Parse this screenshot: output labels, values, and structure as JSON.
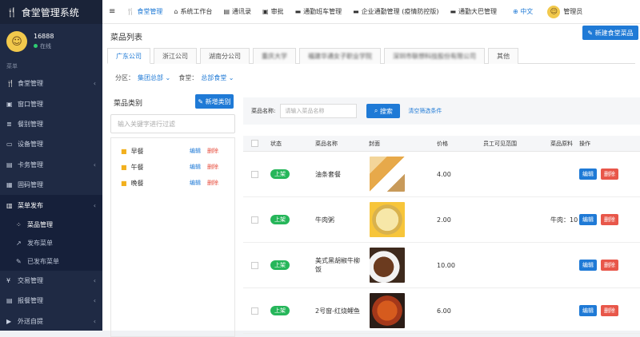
{
  "app": {
    "title": "食堂管理系统"
  },
  "user": {
    "name": "16888",
    "status": "在线"
  },
  "sidebar": {
    "header": "菜单",
    "items": [
      {
        "label": "食堂管理",
        "icon": "fork-knife-icon"
      },
      {
        "label": "窗口管理",
        "icon": "window-icon"
      },
      {
        "label": "餐别管理",
        "icon": "list-icon"
      },
      {
        "label": "设备管理",
        "icon": "device-icon"
      },
      {
        "label": "卡务管理",
        "icon": "card-icon"
      },
      {
        "label": "固码管理",
        "icon": "qr-icon"
      },
      {
        "label": "菜单发布",
        "icon": "document-icon"
      }
    ],
    "subitems": [
      {
        "label": "菜品管理"
      },
      {
        "label": "发布菜单"
      },
      {
        "label": "已发布菜单"
      }
    ],
    "bottom_items": [
      {
        "label": "交易管理"
      },
      {
        "label": "报餐管理"
      },
      {
        "label": "外送自提"
      }
    ]
  },
  "topnav": {
    "items": [
      {
        "label": "食堂管理"
      },
      {
        "label": "系统工作台"
      },
      {
        "label": "通讯录"
      },
      {
        "label": "审批"
      },
      {
        "label": "通勤班车管理"
      },
      {
        "label": "企业通勤管理 (疫情防控版)"
      },
      {
        "label": "通勤大巴管理"
      }
    ],
    "lang": "中文",
    "admin": "管理员"
  },
  "page": {
    "title": "菜品列表",
    "new_cafeteria": "新建食堂菜品",
    "tabs": [
      "广东公司",
      "浙江公司",
      "湖南分公司",
      "重庆大学",
      "福建华通女子职业学院",
      "深圳市联想科技股份有限公司",
      "其他"
    ],
    "filter": {
      "area_label": "分区：",
      "area_value": "集团总部",
      "cafe_label": "食堂：",
      "cafe_value": "总部食堂"
    }
  },
  "categories": {
    "title": "菜品类别",
    "new_button": "新增类别",
    "search_placeholder": "输入关键字进行过滤",
    "edit": "编辑",
    "delete": "删除",
    "items": [
      "早餐",
      "午餐",
      "晚餐"
    ]
  },
  "search": {
    "label": "菜品名称:",
    "placeholder": "请输入菜品名称",
    "button": "搜索",
    "clear": "清空筛选条件"
  },
  "table": {
    "headers": [
      "状态",
      "菜品名称",
      "封面",
      "价格",
      "员工可见范围",
      "菜品原料",
      "操作"
    ],
    "rows": [
      {
        "status": "上架",
        "name": "油条套餐",
        "price": "4.00",
        "ingredients": ""
      },
      {
        "status": "上架",
        "name": "牛肉粥",
        "price": "2.00",
        "ingredients": "牛肉：10"
      },
      {
        "status": "上架",
        "name": "美式黑胡椒牛柳饭",
        "price": "10.00",
        "ingredients": ""
      },
      {
        "status": "上架",
        "name": "2号窗-红烧鲤鱼",
        "price": "6.00",
        "ingredients": ""
      }
    ],
    "edit": "编辑",
    "delete": "删除"
  }
}
